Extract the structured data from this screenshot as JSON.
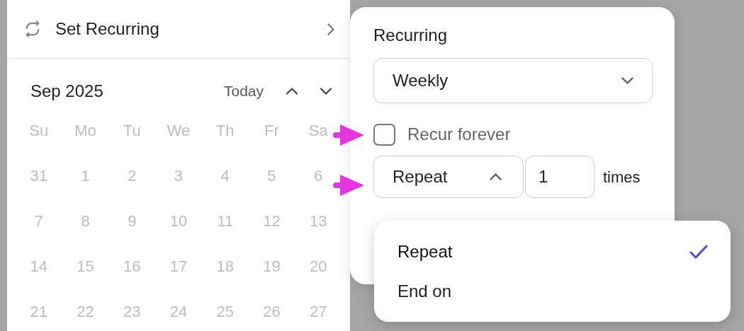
{
  "menu_item": {
    "label": "Set Recurring"
  },
  "calendar": {
    "month": "Sep 2025",
    "today_button": "Today",
    "disabled": true,
    "weekdays": [
      "Su",
      "Mo",
      "Tu",
      "We",
      "Th",
      "Fr",
      "Sa"
    ],
    "weeks": [
      [
        "31",
        "1",
        "2",
        "3",
        "4",
        "5",
        "6"
      ],
      [
        "7",
        "8",
        "9",
        "10",
        "11",
        "12",
        "13"
      ],
      [
        "14",
        "15",
        "16",
        "17",
        "18",
        "19",
        "20"
      ],
      [
        "21",
        "22",
        "23",
        "24",
        "25",
        "26",
        "27"
      ]
    ]
  },
  "recurring": {
    "title": "Recurring",
    "frequency": "Weekly",
    "recur_forever": {
      "label": "Recur forever",
      "checked": false
    },
    "end_mode": {
      "value": "Repeat",
      "expanded": true
    },
    "count": "1",
    "unit": "times"
  },
  "end_menu": [
    {
      "label": "Repeat",
      "selected": true
    },
    {
      "label": "End on",
      "selected": false
    }
  ]
}
